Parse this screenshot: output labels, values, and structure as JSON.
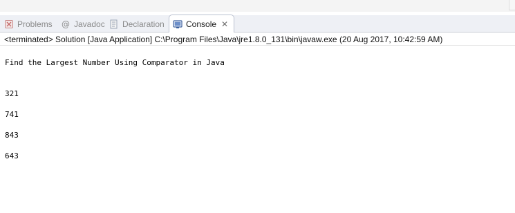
{
  "tabs": {
    "problems": "Problems",
    "javadoc": "Javadoc",
    "declaration": "Declaration",
    "console": "Console",
    "close_symbol": "✕"
  },
  "icons": {
    "problems": "problems-icon",
    "javadoc": "javadoc-at-icon",
    "declaration": "declaration-icon",
    "console": "console-monitor-icon",
    "close": "close-icon"
  },
  "console": {
    "header": "<terminated> Solution [Java Application] C:\\Program Files\\Java\\jre1.8.0_131\\bin\\javaw.exe (20 Aug 2017, 10:42:59 AM)",
    "title_line": "Find the Largest Number Using Comparator in Java",
    "numbers": [
      "321",
      "741",
      "843",
      "643"
    ]
  },
  "colors": {
    "tab_bar": "#eef0f5",
    "active_tab": "#ffffff",
    "inactive_text": "#8a8a8a",
    "console_text": "#000000"
  }
}
